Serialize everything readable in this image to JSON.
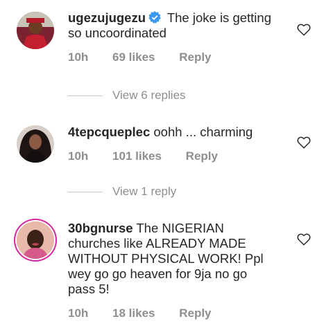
{
  "comments": [
    {
      "username": "ugezujugezu",
      "verified": true,
      "text": "The joke is getting so uncoordinated",
      "time": "10h",
      "likes": "69 likes",
      "reply": "Reply"
    },
    {
      "username": "4tepcqueplec",
      "verified": false,
      "text": "oohh ... charming",
      "time": "10h",
      "likes": "101 likes",
      "reply": "Reply"
    },
    {
      "username": "30bgnurse",
      "verified": false,
      "text": "The NIGERIAN churches like ALREADY MADE WITHOUT PHYSICAL WORK! Ppl wey go go heaven for 9ja no go pass 5!",
      "time": "10h",
      "likes": "18 likes",
      "reply": "Reply"
    }
  ],
  "view_replies": [
    "View 6 replies",
    "View 1 reply"
  ],
  "icons": {
    "verified": "verified-badge-icon",
    "like": "heart-outline-icon"
  },
  "colors": {
    "verified_blue": "#3897f0",
    "muted_text": "#8e8e8e",
    "story_ring": "#d6249f"
  }
}
